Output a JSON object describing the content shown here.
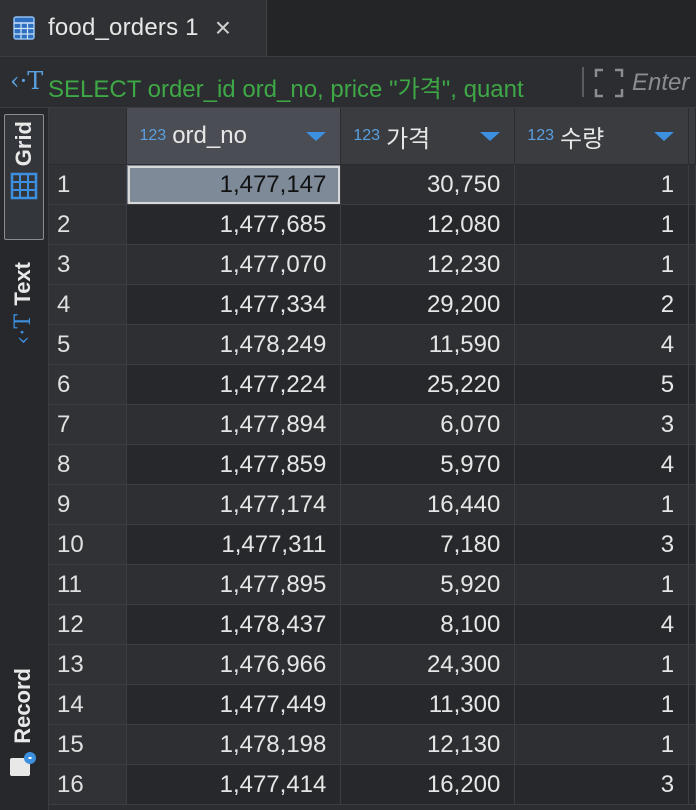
{
  "tab": {
    "title": "food_orders 1",
    "close_glyph": "×",
    "icon": "table-grid-icon"
  },
  "query": {
    "icon": "‹·T",
    "text": "SELECT order_id ord_no, price \"가격\", quant",
    "placeholder": "Enter"
  },
  "left_panel": {
    "grid_label": "Grid",
    "text_label": "Text",
    "record_label": "Record"
  },
  "columns": [
    {
      "type": "123",
      "name": "ord_no"
    },
    {
      "type": "123",
      "name": "가격"
    },
    {
      "type": "123",
      "name": "수량"
    }
  ],
  "rows": [
    {
      "n": "1",
      "ord_no": "1,477,147",
      "price": "30,750",
      "qty": "1"
    },
    {
      "n": "2",
      "ord_no": "1,477,685",
      "price": "12,080",
      "qty": "1"
    },
    {
      "n": "3",
      "ord_no": "1,477,070",
      "price": "12,230",
      "qty": "1"
    },
    {
      "n": "4",
      "ord_no": "1,477,334",
      "price": "29,200",
      "qty": "2"
    },
    {
      "n": "5",
      "ord_no": "1,478,249",
      "price": "11,590",
      "qty": "4"
    },
    {
      "n": "6",
      "ord_no": "1,477,224",
      "price": "25,220",
      "qty": "5"
    },
    {
      "n": "7",
      "ord_no": "1,477,894",
      "price": "6,070",
      "qty": "3"
    },
    {
      "n": "8",
      "ord_no": "1,477,859",
      "price": "5,970",
      "qty": "4"
    },
    {
      "n": "9",
      "ord_no": "1,477,174",
      "price": "16,440",
      "qty": "1"
    },
    {
      "n": "10",
      "ord_no": "1,477,311",
      "price": "7,180",
      "qty": "3"
    },
    {
      "n": "11",
      "ord_no": "1,477,895",
      "price": "5,920",
      "qty": "1"
    },
    {
      "n": "12",
      "ord_no": "1,478,437",
      "price": "8,100",
      "qty": "4"
    },
    {
      "n": "13",
      "ord_no": "1,476,966",
      "price": "24,300",
      "qty": "1"
    },
    {
      "n": "14",
      "ord_no": "1,477,449",
      "price": "11,300",
      "qty": "1"
    },
    {
      "n": "15",
      "ord_no": "1,478,198",
      "price": "12,130",
      "qty": "1"
    },
    {
      "n": "16",
      "ord_no": "1,477,414",
      "price": "16,200",
      "qty": "3"
    }
  ],
  "colors": {
    "accent": "#3d8fe0",
    "sql_green": "#3fa846",
    "selection": "#7f8a99"
  }
}
